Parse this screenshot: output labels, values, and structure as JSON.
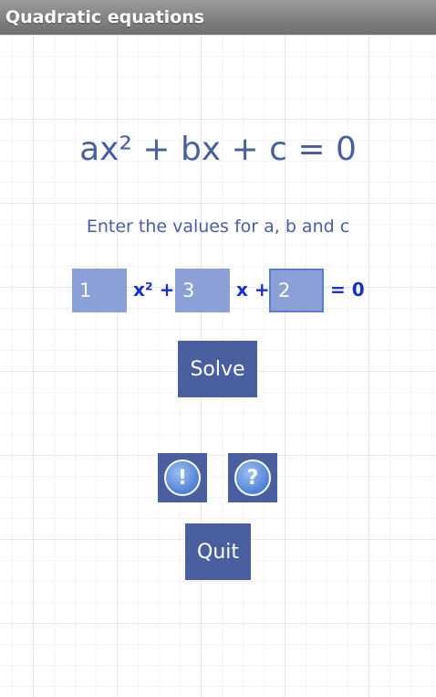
{
  "app": {
    "title": "Quadratic equations"
  },
  "main": {
    "equation": "ax² + bx + c = 0",
    "instructions": "Enter the values for a, b and c",
    "a_value": "1",
    "b_value": "3",
    "c_value": "2",
    "x_squared_label": "x² +",
    "x_label": "x +",
    "equals_label": "= 0",
    "solve_label": "Solve",
    "info_icon": "!",
    "help_icon": "?",
    "quit_label": "Quit"
  },
  "colors": {
    "accent": "#4a5fa0",
    "input_bg": "#8aa0d6",
    "label_blue": "#1830c8"
  }
}
